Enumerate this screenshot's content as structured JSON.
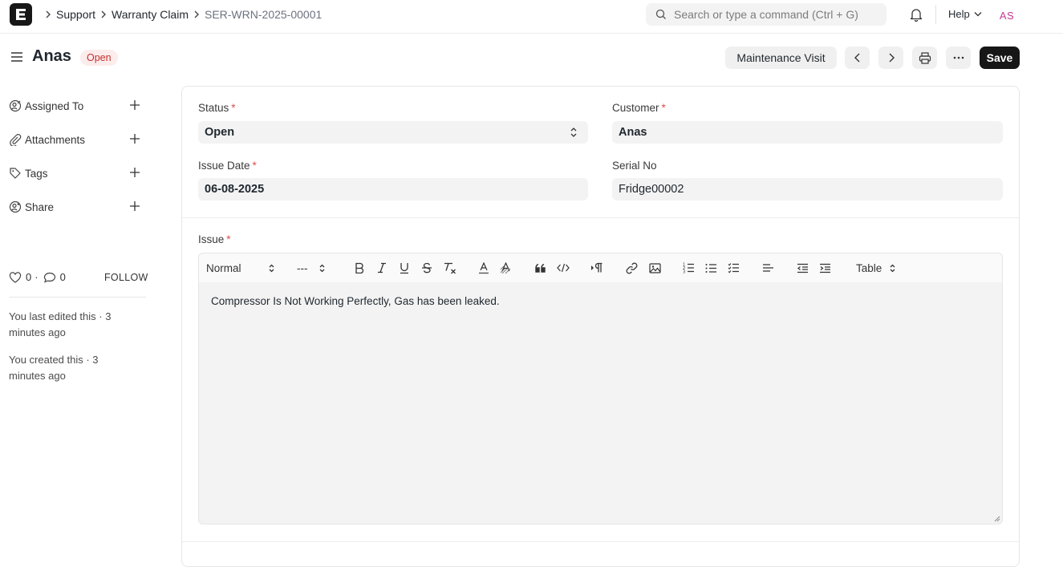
{
  "navbar": {
    "logo_letter": "E",
    "breadcrumbs": [
      "Support",
      "Warranty Claim",
      "SER-WRN-2025-00001"
    ],
    "search_placeholder": "Search or type a command (Ctrl + G)",
    "help_label": "Help",
    "avatar_initials": "AS"
  },
  "page": {
    "title": "Anas",
    "status": "Open",
    "buttons": {
      "maintenance_visit": "Maintenance Visit",
      "save": "Save"
    }
  },
  "sidebar": {
    "items": [
      {
        "label": "Assigned To",
        "icon": "assign-icon"
      },
      {
        "label": "Attachments",
        "icon": "paperclip-icon"
      },
      {
        "label": "Tags",
        "icon": "tag-icon"
      },
      {
        "label": "Share",
        "icon": "share-icon"
      }
    ],
    "likes": "0",
    "comments": "0",
    "follow": "FOLLOW",
    "activity": [
      "You last edited this · 3 minutes ago",
      "You created this · 3 minutes ago"
    ]
  },
  "form": {
    "status": {
      "label": "Status",
      "value": "Open"
    },
    "customer": {
      "label": "Customer",
      "value": "Anas"
    },
    "issue_date": {
      "label": "Issue Date",
      "value": "06-08-2025"
    },
    "serial_no": {
      "label": "Serial No",
      "value": "Fridge00002"
    },
    "issue": {
      "label": "Issue",
      "toolbar": {
        "format": "Normal",
        "size": "---",
        "table": "Table"
      },
      "text": "Compressor Is Not Working Perfectly, Gas has been leaked."
    }
  },
  "colors": {
    "accent": "#171717",
    "status_bg": "#fdecec",
    "status_fg": "#c53030",
    "required": "#e24c4c"
  }
}
